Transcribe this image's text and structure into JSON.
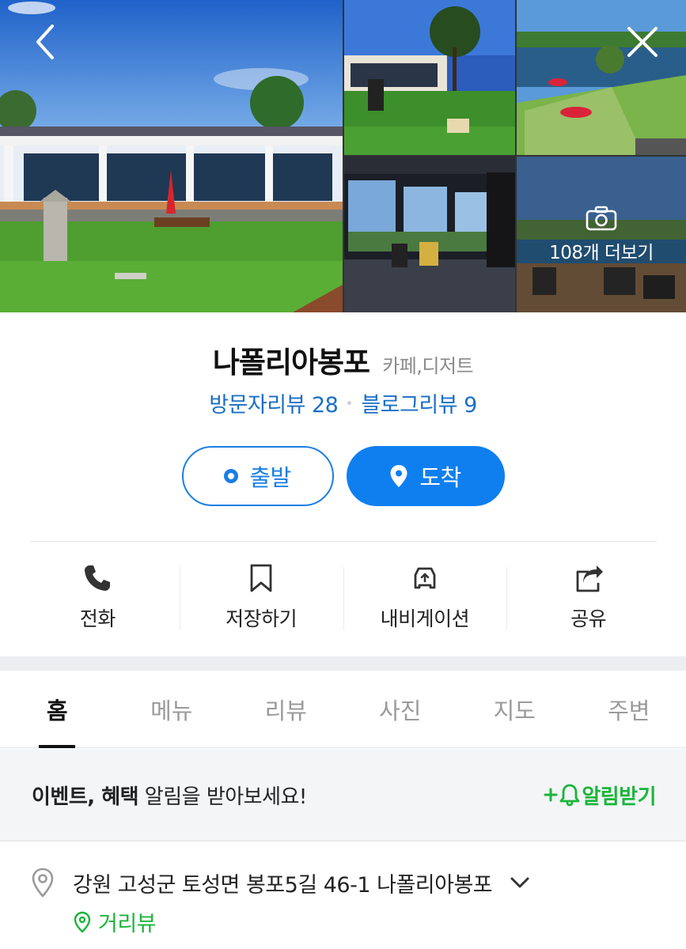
{
  "gallery": {
    "more_label": "108개 더보기"
  },
  "place": {
    "name": "나폴리아봉포",
    "category": "카페,디저트",
    "visitor_reviews": "방문자리뷰 28",
    "blog_reviews": "블로그리뷰 9"
  },
  "route": {
    "start_label": "출발",
    "arrive_label": "도착"
  },
  "actions": [
    {
      "label": "전화",
      "icon": "phone-icon"
    },
    {
      "label": "저장하기",
      "icon": "bookmark-icon"
    },
    {
      "label": "내비게이션",
      "icon": "navigation-car-icon"
    },
    {
      "label": "공유",
      "icon": "share-icon"
    }
  ],
  "tabs": [
    {
      "label": "홈",
      "active": true
    },
    {
      "label": "메뉴",
      "active": false
    },
    {
      "label": "리뷰",
      "active": false
    },
    {
      "label": "사진",
      "active": false
    },
    {
      "label": "지도",
      "active": false
    },
    {
      "label": "주변",
      "active": false
    }
  ],
  "notify": {
    "bold_text": "이벤트, 혜택",
    "text": " 알림을 받아보세요!",
    "button_label": "알림받기"
  },
  "address": {
    "text": "강원 고성군 토성면 봉포5길 46-1 나폴리아봉포",
    "street_view_label": "거리뷰"
  },
  "colors": {
    "accent_blue": "#0f7ff0",
    "review_blue": "#1a6fc6",
    "green": "#1bb53a"
  }
}
